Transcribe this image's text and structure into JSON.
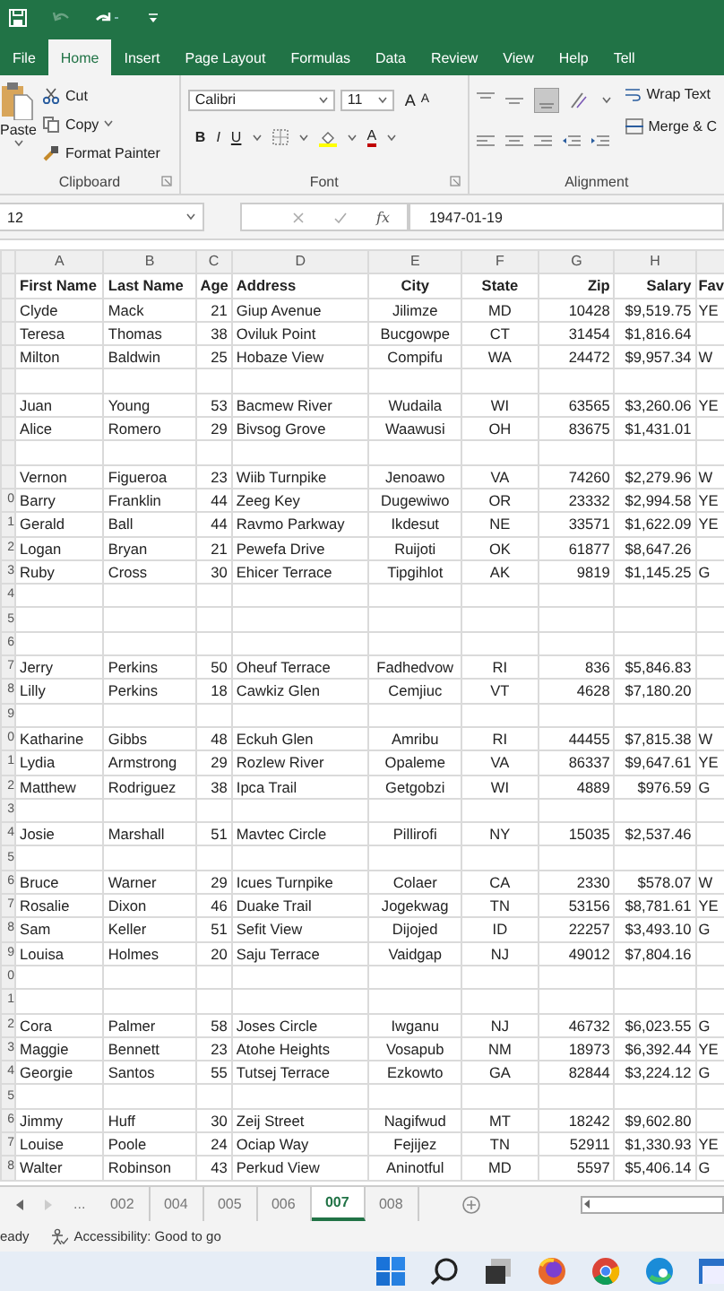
{
  "ribbon_tabs": [
    {
      "label": "File",
      "selected": false
    },
    {
      "label": "Home",
      "selected": true
    },
    {
      "label": "Insert",
      "selected": false
    },
    {
      "label": "Page Layout",
      "selected": false
    },
    {
      "label": "Formulas",
      "selected": false
    },
    {
      "label": "Data",
      "selected": false
    },
    {
      "label": "Review",
      "selected": false
    },
    {
      "label": "View",
      "selected": false
    },
    {
      "label": "Help",
      "selected": false
    },
    {
      "label": "Tell",
      "selected": false
    }
  ],
  "clipboard": {
    "paste": "Paste",
    "cut": "Cut",
    "copy": "Copy",
    "format_painter": "Format Painter",
    "label": "Clipboard"
  },
  "font": {
    "name": "Calibri",
    "size": "11",
    "grow": "A",
    "shrink": "A",
    "bold": "B",
    "italic": "I",
    "underline": "U",
    "font_color_button": "A",
    "label": "Font"
  },
  "alignment": {
    "wrap_text": "Wrap Text",
    "merge": "Merge & C",
    "label": "Alignment"
  },
  "formula_bar": {
    "name_box": "12",
    "function_label": "fx",
    "value": "1947-01-19"
  },
  "sheet": {
    "columns": [
      "A",
      "B",
      "C",
      "D",
      "E",
      "F",
      "G",
      "H"
    ],
    "rows": [
      {
        "first_name": "First Name",
        "last_name": "Last Name",
        "age": "Age",
        "address": "Address",
        "city": "City",
        "state": "State",
        "zip": "Zip",
        "salary": "Salary",
        "column_9": "Fav"
      },
      {
        "first_name": "Clyde",
        "last_name": "Mack",
        "age": "21",
        "address": "Giup Avenue",
        "city": "Jilimze",
        "state": "MD",
        "zip": "10428",
        "salary": "$9,519.75",
        "column_9": "YE"
      },
      {
        "first_name": "Teresa",
        "last_name": "Thomas",
        "age": "38",
        "address": "Oviluk Point",
        "city": "Bucgowpe",
        "state": "CT",
        "zip": "31454",
        "salary": "$1,816.64"
      },
      {
        "first_name": "Milton",
        "last_name": "Baldwin",
        "age": "25",
        "address": "Hobaze View",
        "city": "Compifu",
        "state": "WA",
        "zip": "24472",
        "salary": "$9,957.34",
        "column_9": "W"
      },
      {},
      {
        "first_name": "Juan",
        "last_name": "Young",
        "age": "53",
        "address": "Bacmew River",
        "city": "Wudaila",
        "state": "WI",
        "zip": "63565",
        "salary": "$3,260.06",
        "column_9": "YE"
      },
      {
        "first_name": "Alice",
        "last_name": "Romero",
        "age": "29",
        "address": "Bivsog Grove",
        "city": "Waawusi",
        "state": "OH",
        "zip": "83675",
        "salary": "$1,431.01"
      },
      {},
      {
        "first_name": "Vernon",
        "last_name": "Figueroa",
        "age": "23",
        "address": "Wiib Turnpike",
        "city": "Jenoawo",
        "state": "VA",
        "zip": "74260",
        "salary": "$2,279.96",
        "column_9": "W"
      },
      {
        "row_label": "0",
        "first_name": "Barry",
        "last_name": "Franklin",
        "age": "44",
        "address": "Zeeg Key",
        "city": "Dugewiwo",
        "state": "OR",
        "zip": "23332",
        "salary": "$2,994.58",
        "column_9": "YE"
      },
      {
        "row_label": "1",
        "first_name": "Gerald",
        "last_name": "Ball",
        "age": "44",
        "address": "Ravmo Parkway",
        "city": "Ikdesut",
        "state": "NE",
        "zip": "33571",
        "salary": "$1,622.09",
        "column_9": "YE"
      },
      {
        "row_label": "2",
        "first_name": "Logan",
        "last_name": "Bryan",
        "age": "21",
        "address": "Pewefa Drive",
        "city": "Ruijoti",
        "state": "OK",
        "zip": "61877",
        "salary": "$8,647.26"
      },
      {
        "row_label": "3",
        "first_name": "Ruby",
        "last_name": "Cross",
        "age": "30",
        "address": "Ehicer Terrace",
        "city": "Tipgihlot",
        "state": "AK",
        "zip": "9819",
        "salary": "$1,145.25",
        "column_9": "G"
      },
      {
        "row_label": "4"
      },
      {
        "row_label": "5"
      },
      {
        "row_label": "6"
      },
      {
        "row_label": "7",
        "first_name": "Jerry",
        "last_name": "Perkins",
        "age": "50",
        "address": "Oheuf Terrace",
        "city": "Fadhedvow",
        "state": "RI",
        "zip": "836",
        "salary": "$5,846.83"
      },
      {
        "row_label": "8",
        "first_name": "Lilly",
        "last_name": "Perkins",
        "age": "18",
        "address": "Cawkiz Glen",
        "city": "Cemjiuc",
        "state": "VT",
        "zip": "4628",
        "salary": "$7,180.20"
      },
      {
        "row_label": "9"
      },
      {
        "row_label": "0",
        "first_name": "Katharine",
        "last_name": "Gibbs",
        "age": "48",
        "address": "Eckuh Glen",
        "city": "Amribu",
        "state": "RI",
        "zip": "44455",
        "salary": "$7,815.38",
        "column_9": "W"
      },
      {
        "row_label": "1",
        "first_name": "Lydia",
        "last_name": "Armstrong",
        "age": "29",
        "address": "Rozlew River",
        "city": "Opaleme",
        "state": "VA",
        "zip": "86337",
        "salary": "$9,647.61",
        "column_9": "YE"
      },
      {
        "row_label": "2",
        "first_name": "Matthew",
        "last_name": "Rodriguez",
        "age": "38",
        "address": "Ipca Trail",
        "city": "Getgobzi",
        "state": "WI",
        "zip": "4889",
        "salary": "$976.59",
        "column_9": "G"
      },
      {
        "row_label": "3"
      },
      {
        "row_label": "4",
        "first_name": "Josie",
        "last_name": "Marshall",
        "age": "51",
        "address": "Mavtec Circle",
        "city": "Pillirofi",
        "state": "NY",
        "zip": "15035",
        "salary": "$2,537.46"
      },
      {
        "row_label": "5"
      },
      {
        "row_label": "6",
        "first_name": "Bruce",
        "last_name": "Warner",
        "age": "29",
        "address": "Icues Turnpike",
        "city": "Colaer",
        "state": "CA",
        "zip": "2330",
        "salary": "$578.07",
        "column_9": "W"
      },
      {
        "row_label": "7",
        "first_name": "Rosalie",
        "last_name": "Dixon",
        "age": "46",
        "address": "Duake Trail",
        "city": "Jogekwag",
        "state": "TN",
        "zip": "53156",
        "salary": "$8,781.61",
        "column_9": "YE"
      },
      {
        "row_label": "8",
        "first_name": "Sam",
        "last_name": "Keller",
        "age": "51",
        "address": "Sefit View",
        "city": "Dijojed",
        "state": "ID",
        "zip": "22257",
        "salary": "$3,493.10",
        "column_9": "G"
      },
      {
        "row_label": "9",
        "first_name": "Louisa",
        "last_name": "Holmes",
        "age": "20",
        "address": "Saju Terrace",
        "city": "Vaidgap",
        "state": "NJ",
        "zip": "49012",
        "salary": "$7,804.16"
      },
      {
        "row_label": "0"
      },
      {
        "row_label": "1"
      },
      {
        "row_label": "2",
        "first_name": "Cora",
        "last_name": "Palmer",
        "age": "58",
        "address": "Joses Circle",
        "city": "Iwganu",
        "state": "NJ",
        "zip": "46732",
        "salary": "$6,023.55",
        "column_9": "G"
      },
      {
        "row_label": "3",
        "first_name": "Maggie",
        "last_name": "Bennett",
        "age": "23",
        "address": "Atohe Heights",
        "city": "Vosapub",
        "state": "NM",
        "zip": "18973",
        "salary": "$6,392.44",
        "column_9": "YE"
      },
      {
        "row_label": "4",
        "first_name": "Georgie",
        "last_name": "Santos",
        "age": "55",
        "address": "Tutsej Terrace",
        "city": "Ezkowto",
        "state": "GA",
        "zip": "82844",
        "salary": "$3,224.12",
        "column_9": "G"
      },
      {
        "row_label": "5"
      },
      {
        "row_label": "6",
        "first_name": "Jimmy",
        "last_name": "Huff",
        "age": "30",
        "address": "Zeij Street",
        "city": "Nagifwud",
        "state": "MT",
        "zip": "18242",
        "salary": "$9,602.80"
      },
      {
        "row_label": "7",
        "first_name": "Louise",
        "last_name": "Poole",
        "age": "24",
        "address": "Ociap Way",
        "city": "Fejijez",
        "state": "TN",
        "zip": "52911",
        "salary": "$1,330.93",
        "column_9": "YE"
      },
      {
        "row_label": "8",
        "first_name": "Walter",
        "last_name": "Robinson",
        "age": "43",
        "address": "Perkud View",
        "city": "Aninotful",
        "state": "MD",
        "zip": "5597",
        "salary": "$5,406.14",
        "column_9": "G"
      }
    ]
  },
  "sheet_tabs": {
    "more": "...",
    "tabs": [
      {
        "label": "002",
        "selected": false
      },
      {
        "label": "004",
        "selected": false
      },
      {
        "label": "005",
        "selected": false
      },
      {
        "label": "006",
        "selected": false
      },
      {
        "label": "007",
        "selected": true
      },
      {
        "label": "008",
        "selected": false
      }
    ]
  },
  "status_bar": {
    "mode": "eady",
    "accessibility": "Accessibility: Good to go"
  }
}
